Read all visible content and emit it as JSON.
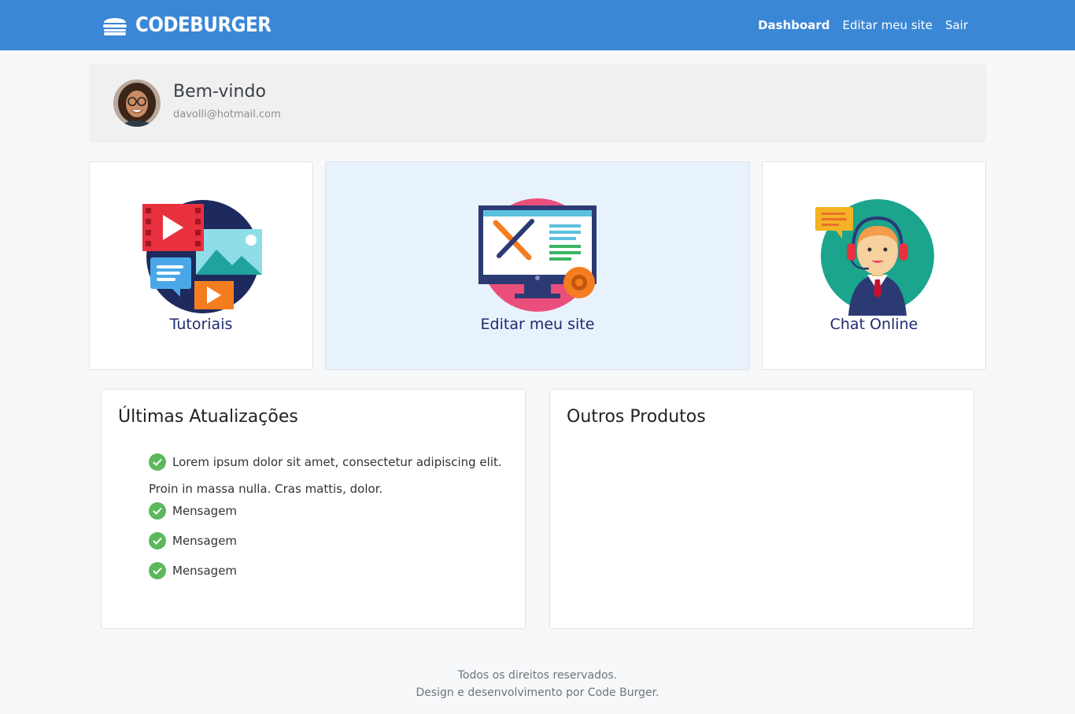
{
  "brand": {
    "name": "CODEBURGER"
  },
  "nav": [
    {
      "label": "Dashboard",
      "active": true
    },
    {
      "label": "Editar meu site",
      "active": false
    },
    {
      "label": "Sair",
      "active": false
    }
  ],
  "welcome": {
    "title": "Bem-vindo",
    "email": "davolli@hotmail.com"
  },
  "cards": {
    "tutoriais": {
      "label": "Tutoriais",
      "icon": "video-media-icon"
    },
    "editar": {
      "label": "Editar meu site",
      "icon": "monitor-tools-icon"
    },
    "chat": {
      "label": "Chat Online",
      "icon": "support-agent-icon"
    }
  },
  "updates": {
    "title": "Últimas Atualizações",
    "items": [
      "Lorem ipsum dolor sit amet, consectetur adipiscing elit.",
      "Proin in massa nulla. Cras mattis, dolor.",
      "Mensagem",
      "Mensagem",
      "Mensagem"
    ]
  },
  "products": {
    "title": "Outros Produtos"
  },
  "footer": {
    "line1": "Todos os direitos reservados.",
    "line2": "Design e desenvolvimento por Code Burger."
  },
  "colors": {
    "navbar": "#3a87d6",
    "card_title": "#1f2b6f",
    "check": "#5cb85c",
    "highlight": "#e8f2fc"
  }
}
